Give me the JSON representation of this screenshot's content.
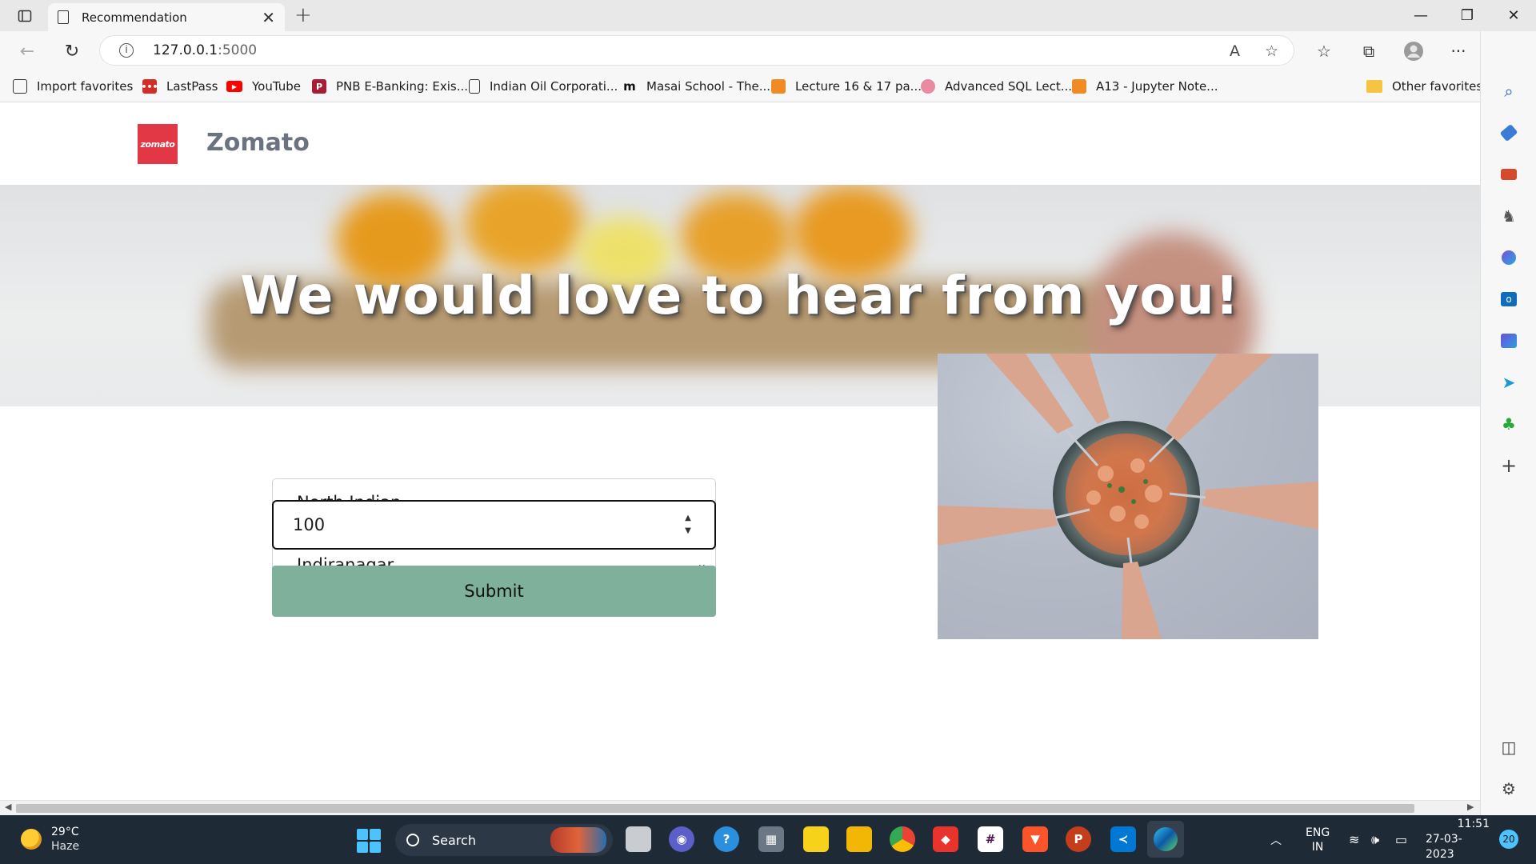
{
  "browser": {
    "tab_title": "Recommendation",
    "url_host": "127.0.0.1",
    "url_port": ":5000",
    "favorites": [
      {
        "label": "Import favorites",
        "icon": "import-icon",
        "color": "#333333"
      },
      {
        "label": "LastPass",
        "icon": "lastpass-icon",
        "color": "#d32d27"
      },
      {
        "label": "YouTube",
        "icon": "youtube-icon",
        "color": "#ff0000"
      },
      {
        "label": "PNB E-Banking: Exis...",
        "icon": "pnb-icon",
        "color": "#a41e35"
      },
      {
        "label": "Indian Oil Corporati...",
        "icon": "page-icon",
        "color": "#333333"
      },
      {
        "label": "Masai School - The...",
        "icon": "masai-icon",
        "color": "#111111"
      },
      {
        "label": "Lecture 16 & 17 pa...",
        "icon": "notebook-icon",
        "color": "#f08a24"
      },
      {
        "label": "Advanced SQL Lect...",
        "icon": "brain-icon",
        "color": "#e88aa0"
      },
      {
        "label": "A13 - Jupyter Note...",
        "icon": "notebook-icon",
        "color": "#f08a24"
      }
    ],
    "other_favorites": "Other favorites"
  },
  "page": {
    "brand_logo_text": "zomato",
    "brand_name": "Zomato",
    "hero_title": "We would love to hear from you!",
    "form": {
      "cuisine_selected": "North Indian",
      "location_selected": "Indiranagar",
      "amount_value": "100",
      "submit_label": "Submit"
    }
  },
  "taskbar": {
    "temperature": "29°C",
    "weather": "Haze",
    "search_label": "Search",
    "lang_line1": "ENG",
    "lang_line2": "IN",
    "time": "11:51",
    "date": "27-03-2023",
    "notification_count": "20"
  },
  "colors": {
    "brand_red": "#e23744",
    "submit_green": "#7fb09c",
    "taskbar_bg": "#1f2a37"
  }
}
